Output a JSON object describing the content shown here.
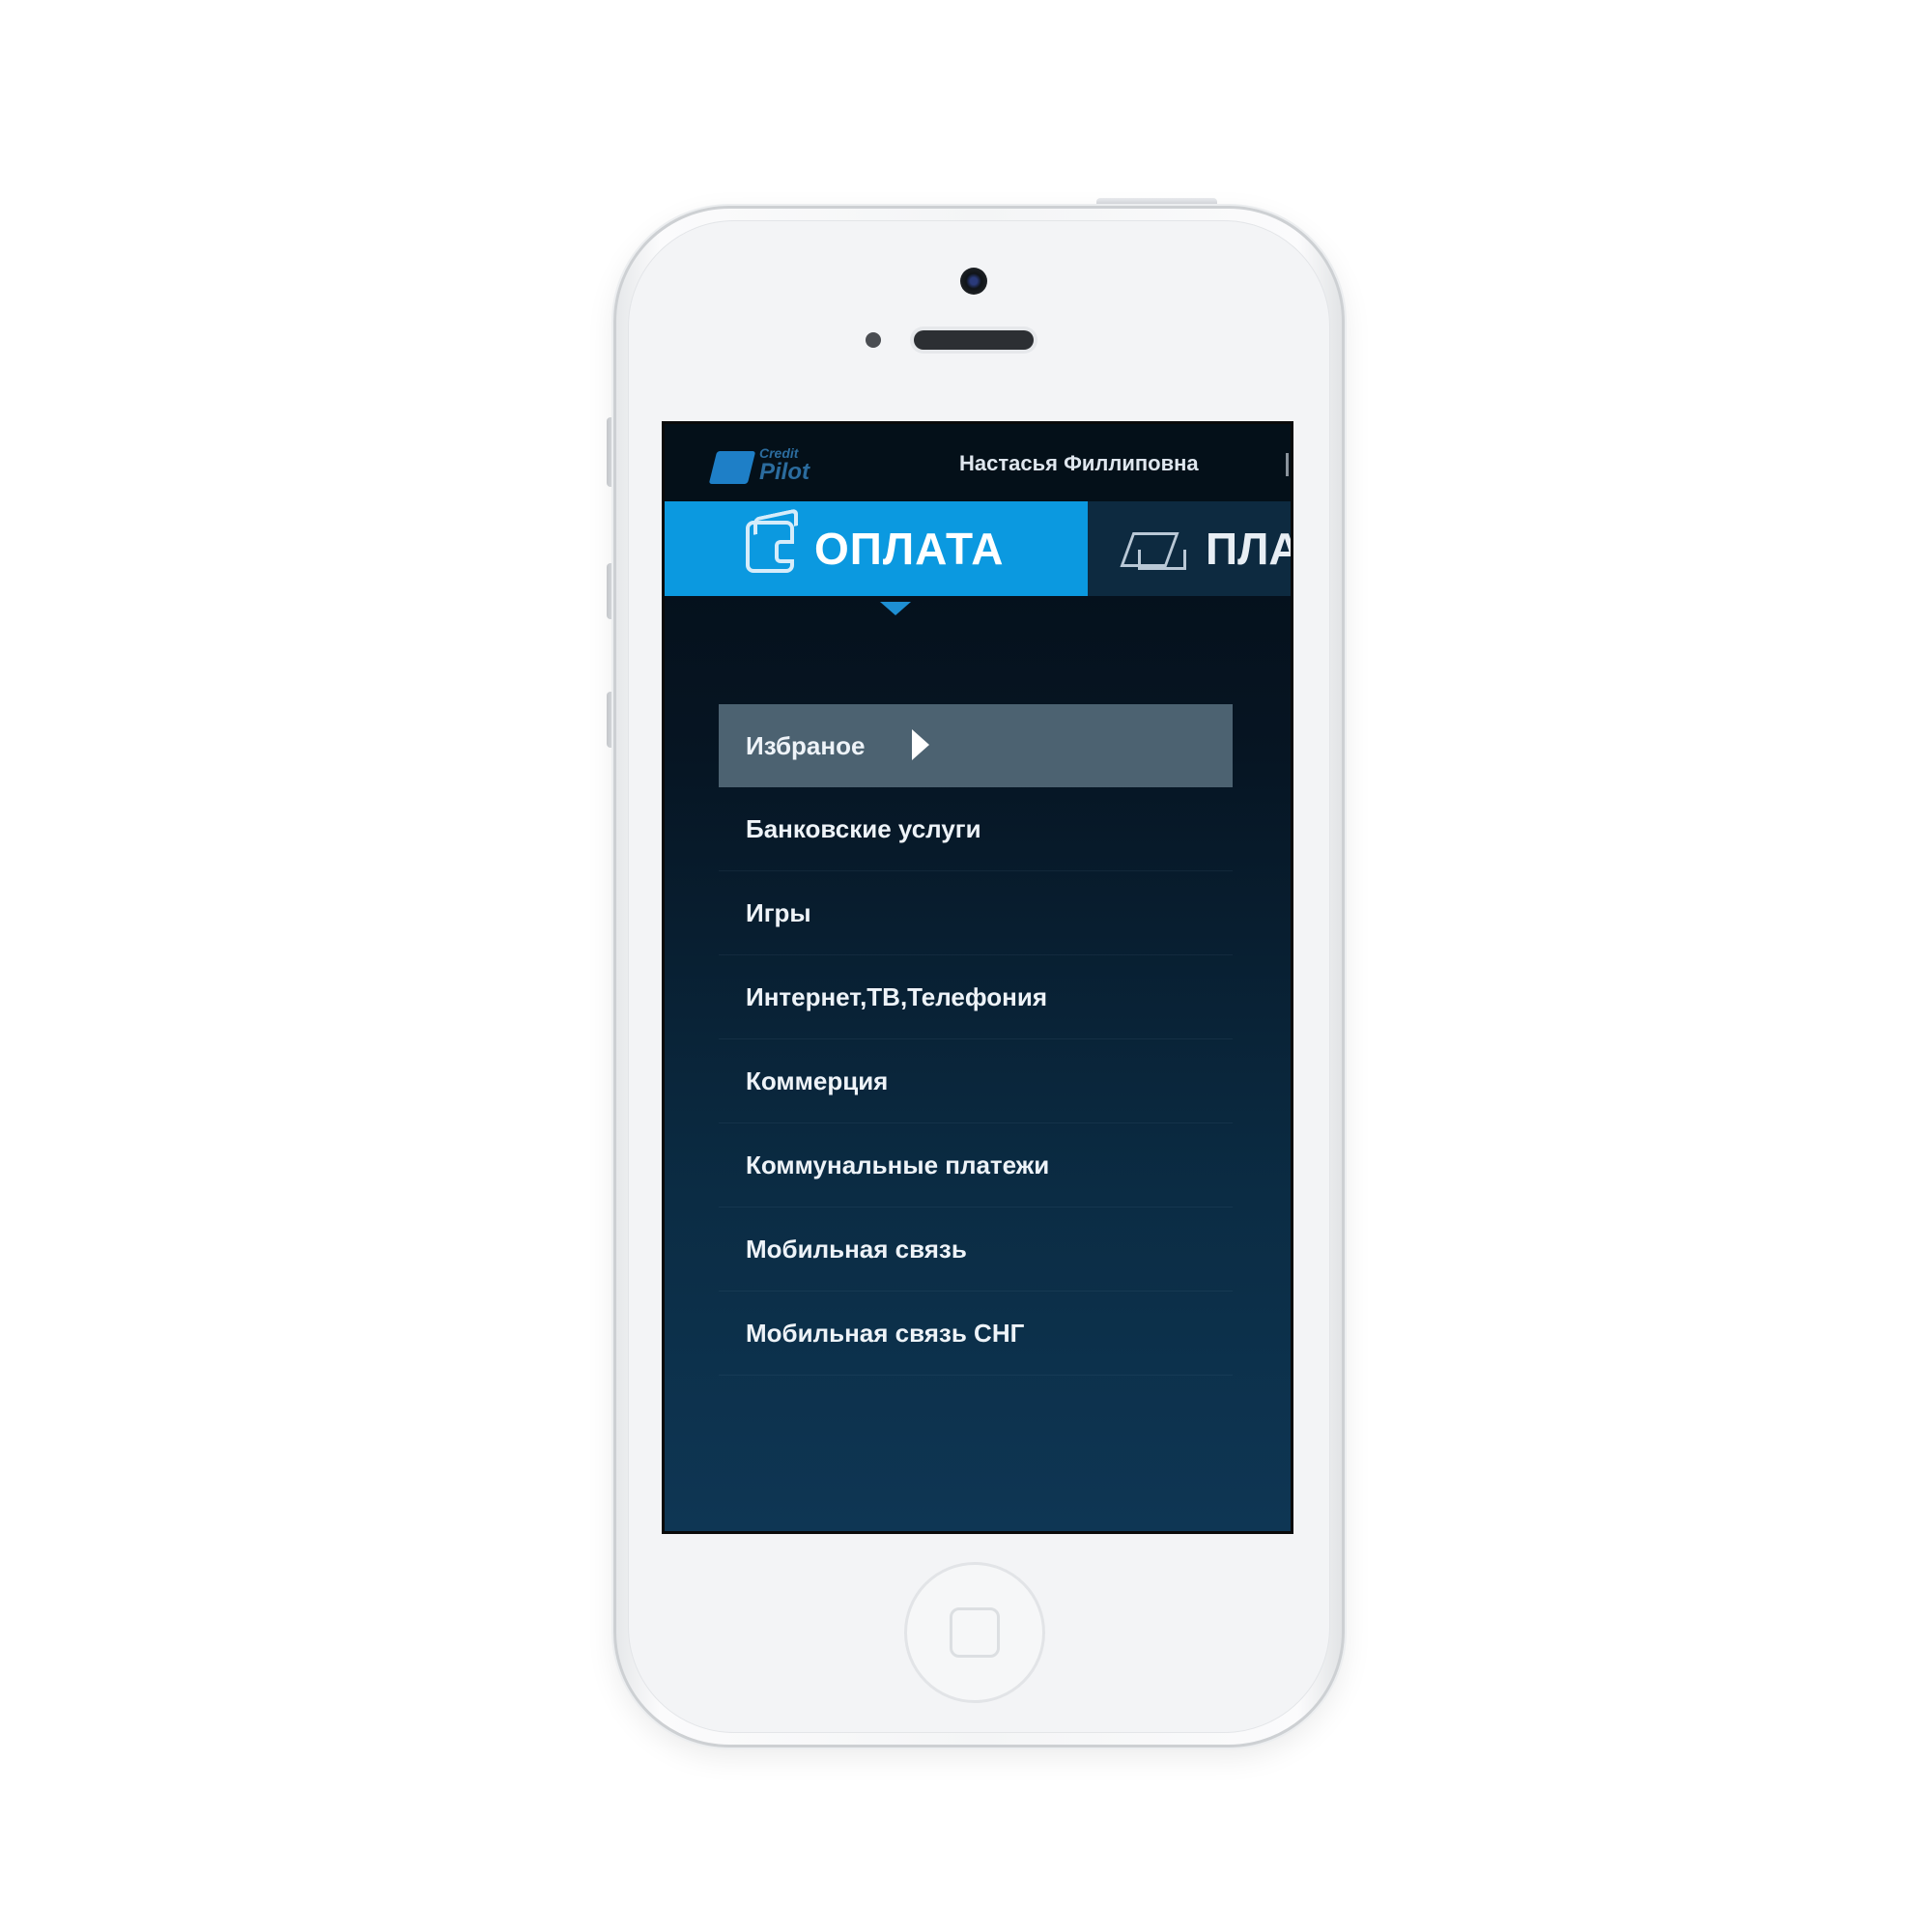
{
  "app": {
    "logo": {
      "line1": "Credit",
      "line2": "Pilot"
    },
    "user_name": "Настасья Филлиповна"
  },
  "tabs": [
    {
      "label": "ОПЛАТА",
      "icon": "wallet-icon",
      "active": true
    },
    {
      "label": "ПЛА",
      "icon": "document-tray-icon",
      "active": false
    }
  ],
  "menu": {
    "items": [
      {
        "label": "Избраное",
        "active": true
      },
      {
        "label": "Банковские услуги"
      },
      {
        "label": "Игры"
      },
      {
        "label": "Интернет,ТВ,Телефония"
      },
      {
        "label": "Коммерция"
      },
      {
        "label": "Коммунальные платежи"
      },
      {
        "label": "Мобильная связь"
      },
      {
        "label": "Мобильная связь СНГ"
      }
    ]
  },
  "colors": {
    "accent": "#0b99e0",
    "active_item": "#4c6271",
    "background_top": "#040d16",
    "background_bottom": "#0e3654"
  }
}
